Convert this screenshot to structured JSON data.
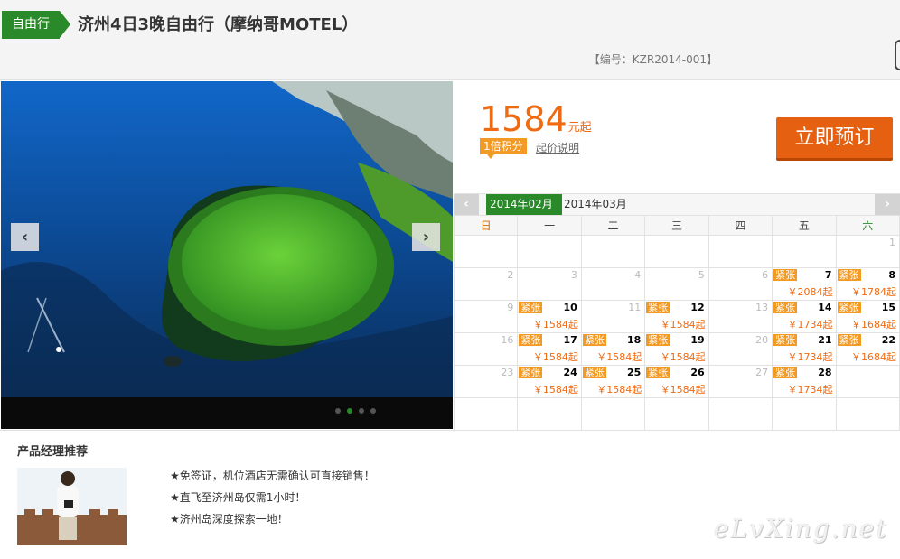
{
  "header": {
    "tag": "自由行",
    "title": "济州4日3晚自由行（摩纳哥MOTEL）",
    "code": "【编号：KZR2014-001】"
  },
  "slider": {
    "prev_icon": "‹",
    "next_icon": "›",
    "slide_count": 4,
    "active_slide": 2
  },
  "pricing": {
    "price": "1584",
    "unit": "元起",
    "points_badge": "1倍积分",
    "price_note": "起价说明",
    "book_label": "立即预订"
  },
  "calendar": {
    "prev_icon": "‹",
    "next_icon": "›",
    "months": [
      "2014年02月",
      "2014年03月"
    ],
    "weekdays": [
      "日",
      "一",
      "二",
      "三",
      "四",
      "五",
      "六"
    ],
    "weeks": [
      [
        null,
        null,
        null,
        null,
        null,
        null,
        {
          "day": "1"
        }
      ],
      [
        {
          "day": "2"
        },
        {
          "day": "3"
        },
        {
          "day": "4"
        },
        {
          "day": "5"
        },
        {
          "day": "6"
        },
        {
          "day": "7",
          "badge": "紧张",
          "price": "￥2084起"
        },
        {
          "day": "8",
          "badge": "紧张",
          "price": "￥1784起"
        }
      ],
      [
        {
          "day": "9"
        },
        {
          "day": "10",
          "badge": "紧张",
          "price": "￥1584起"
        },
        {
          "day": "11"
        },
        {
          "day": "12",
          "badge": "紧张",
          "price": "￥1584起"
        },
        {
          "day": "13"
        },
        {
          "day": "14",
          "badge": "紧张",
          "price": "￥1734起"
        },
        {
          "day": "15",
          "badge": "紧张",
          "price": "￥1684起"
        }
      ],
      [
        {
          "day": "16"
        },
        {
          "day": "17",
          "badge": "紧张",
          "price": "￥1584起"
        },
        {
          "day": "18",
          "badge": "紧张",
          "price": "￥1584起"
        },
        {
          "day": "19",
          "badge": "紧张",
          "price": "￥1584起"
        },
        {
          "day": "20"
        },
        {
          "day": "21",
          "badge": "紧张",
          "price": "￥1734起"
        },
        {
          "day": "22",
          "badge": "紧张",
          "price": "￥1684起"
        }
      ],
      [
        {
          "day": "23"
        },
        {
          "day": "24",
          "badge": "紧张",
          "price": "￥1584起"
        },
        {
          "day": "25",
          "badge": "紧张",
          "price": "￥1584起"
        },
        {
          "day": "26",
          "badge": "紧张",
          "price": "￥1584起"
        },
        {
          "day": "27"
        },
        {
          "day": "28",
          "badge": "紧张",
          "price": "￥1734起"
        },
        null
      ],
      [
        null,
        null,
        null,
        null,
        null,
        null,
        null
      ]
    ]
  },
  "recommend": {
    "title": "产品经理推荐",
    "features": [
      "★免签证，机位酒店无需确认可直接销售！",
      "★直飞至济州岛仅需1小时！",
      "★济州岛深度探索一地！"
    ]
  },
  "watermark": "eLvXing.net",
  "colors": {
    "brand_green": "#2a8a2a",
    "price_orange": "#ee6a13",
    "badge_orange": "#f39a24",
    "book_button": "#e66012"
  }
}
